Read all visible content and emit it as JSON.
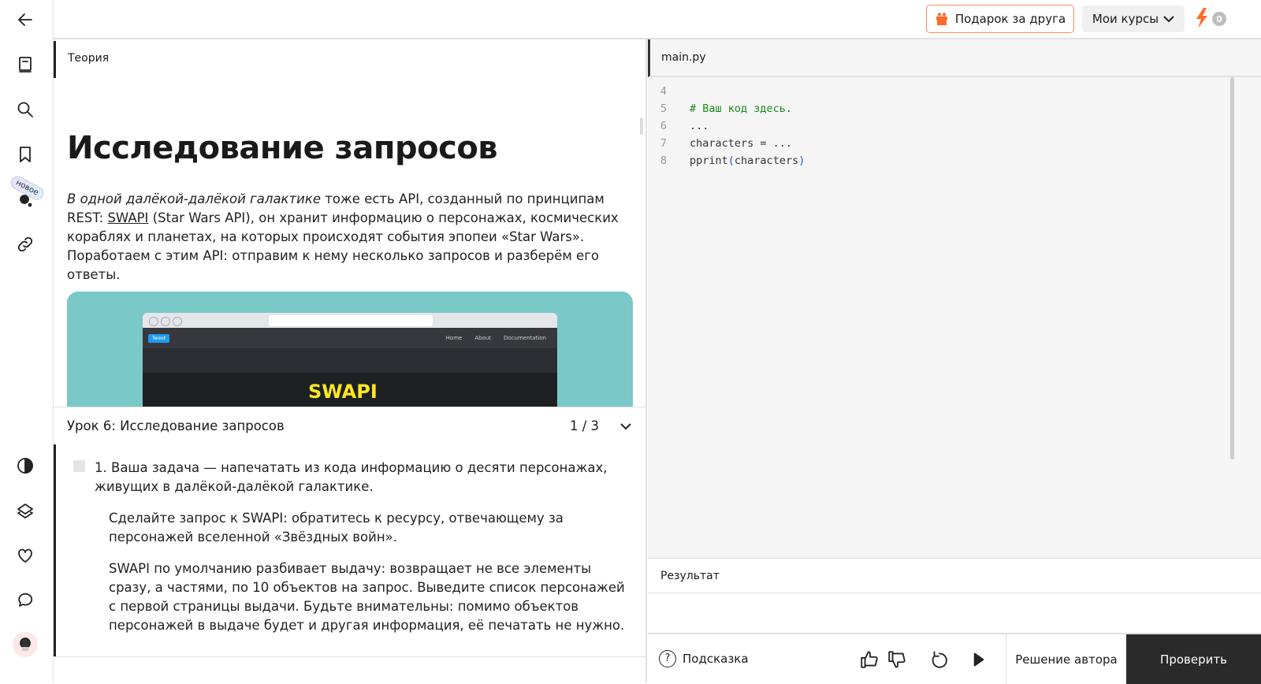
{
  "sidebar": {
    "new_badge": "новое"
  },
  "topbar": {
    "gift_label": "Подарок за друга",
    "courses_label": "Мои курсы",
    "streak_count": "0",
    "accent": "#ff6a2b"
  },
  "theory": {
    "tab_label": "Теория",
    "title": "Исследование запросов",
    "para_italic": "В одной далёкой-далёкой галактике",
    "para_1": " тоже есть API, созданный по принципам REST: ",
    "para_link": "SWAPI",
    "para_2": " (Star Wars API), он хранит информацию о персонажах, космических кораблях и планетах, на которых происходят события эпопеи «Star Wars». Поработаем с этим API: отправим к нему несколько запросов и разберём его ответы.",
    "image": {
      "tweet": "Tweet",
      "nav": [
        "Home",
        "About",
        "Documentation"
      ],
      "logo": "SWAPI"
    }
  },
  "lesson": {
    "title": "Урок 6: Исследование запросов",
    "page": "1 / 3"
  },
  "task": {
    "number": "1.",
    "p1": "Ваша задача — напечатать из кода информацию о десяти персонажах, живущих в далёкой-далёкой галактике.",
    "p2": "Сделайте запрос к SWAPI: обратитесь к ресурсу, отвечающему за персонажей вселенной «Звёздных войн».",
    "p3": "SWAPI по умолчанию разбивает выдачу: возвращает не все элементы сразу, а частями, по 10 объектов на запрос. Выведите список персонажей с первой страницы выдачи. Будьте внимательны: помимо объектов персонажей в выдаче будет и другая информация, её печатать не нужно."
  },
  "editor": {
    "file": "main.py",
    "lines": [
      {
        "n": "4",
        "t": ""
      },
      {
        "n": "5",
        "t": "# Ваш код здесь."
      },
      {
        "n": "6",
        "t": "..."
      },
      {
        "n": "7",
        "t": "characters = ..."
      },
      {
        "n": "8",
        "a": "pprint",
        "b": "(",
        "c": "characters",
        "d": ")"
      }
    ]
  },
  "result": {
    "label": "Результат"
  },
  "actions": {
    "hint": "Подсказка",
    "author_solution": "Решение автора",
    "check": "Проверить"
  }
}
